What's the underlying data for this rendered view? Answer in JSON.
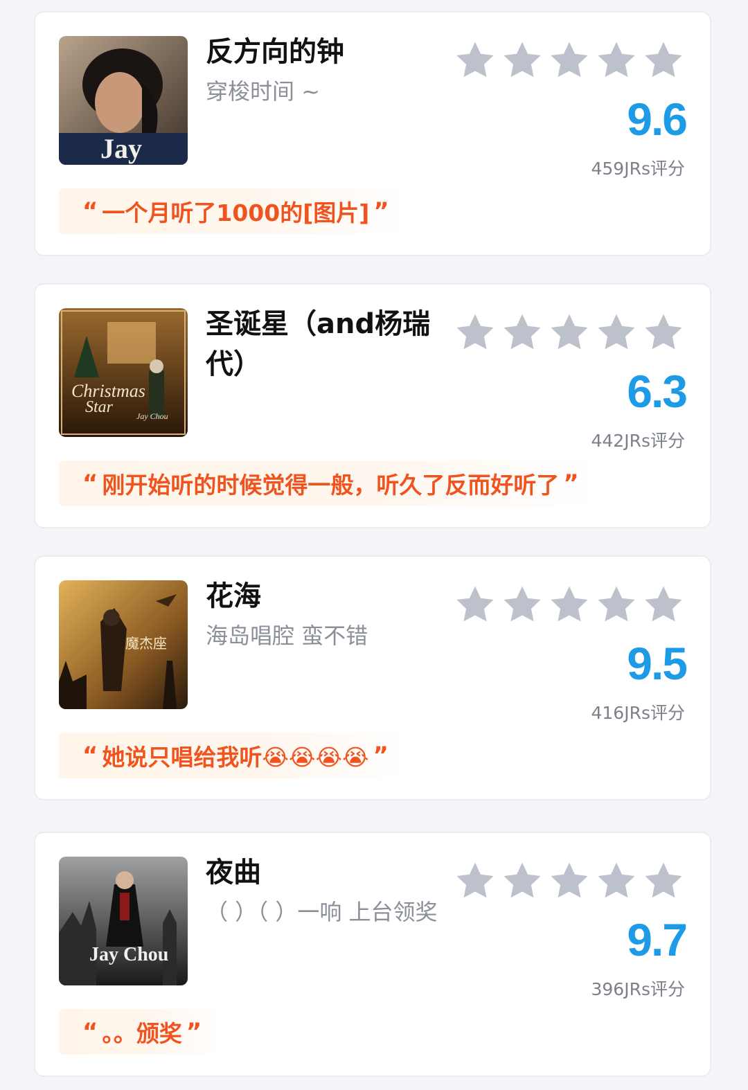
{
  "colors": {
    "score_blue": "#1e9be6",
    "quote_orange": "#f0531e",
    "star_gray": "#bcc1cb",
    "card_bg": "#ffffff",
    "page_bg": "#f4f5f8"
  },
  "songs": [
    {
      "title": "反方向的钟",
      "subtitle": "穿梭时间 ~",
      "score": "9.6",
      "rater_count": "459JRs",
      "rating_suffix": "评分",
      "quote_open": "“",
      "quote_text": "一个月听了1000的[图片]",
      "quote_close": "”",
      "cover_icon": "album-cover-jay",
      "stars_filled": 0
    },
    {
      "title": "圣诞星（and杨瑞代）",
      "subtitle": "",
      "score": "6.3",
      "rater_count": "442JRs",
      "rating_suffix": "评分",
      "quote_open": "“",
      "quote_text": "刚开始听的时候觉得一般，听久了反而好听了",
      "quote_close": "”",
      "cover_icon": "album-cover-christmas-star",
      "stars_filled": 0
    },
    {
      "title": "花海",
      "subtitle": "海岛唱腔 蛮不错",
      "score": "9.5",
      "rater_count": "416JRs",
      "rating_suffix": "评分",
      "quote_open": "“",
      "quote_text": "她说只唱给我听😭😭😭😭",
      "quote_close": "”",
      "cover_icon": "album-cover-capricorn",
      "stars_filled": 0
    },
    {
      "title": "夜曲",
      "subtitle": "（ ）（ ）一响 上台领奖",
      "score": "9.7",
      "rater_count": "396JRs",
      "rating_suffix": "评分",
      "quote_open": "“",
      "quote_text": "。。颁奖",
      "quote_close": "”",
      "cover_icon": "album-cover-november-chopin",
      "stars_filled": 0
    }
  ]
}
